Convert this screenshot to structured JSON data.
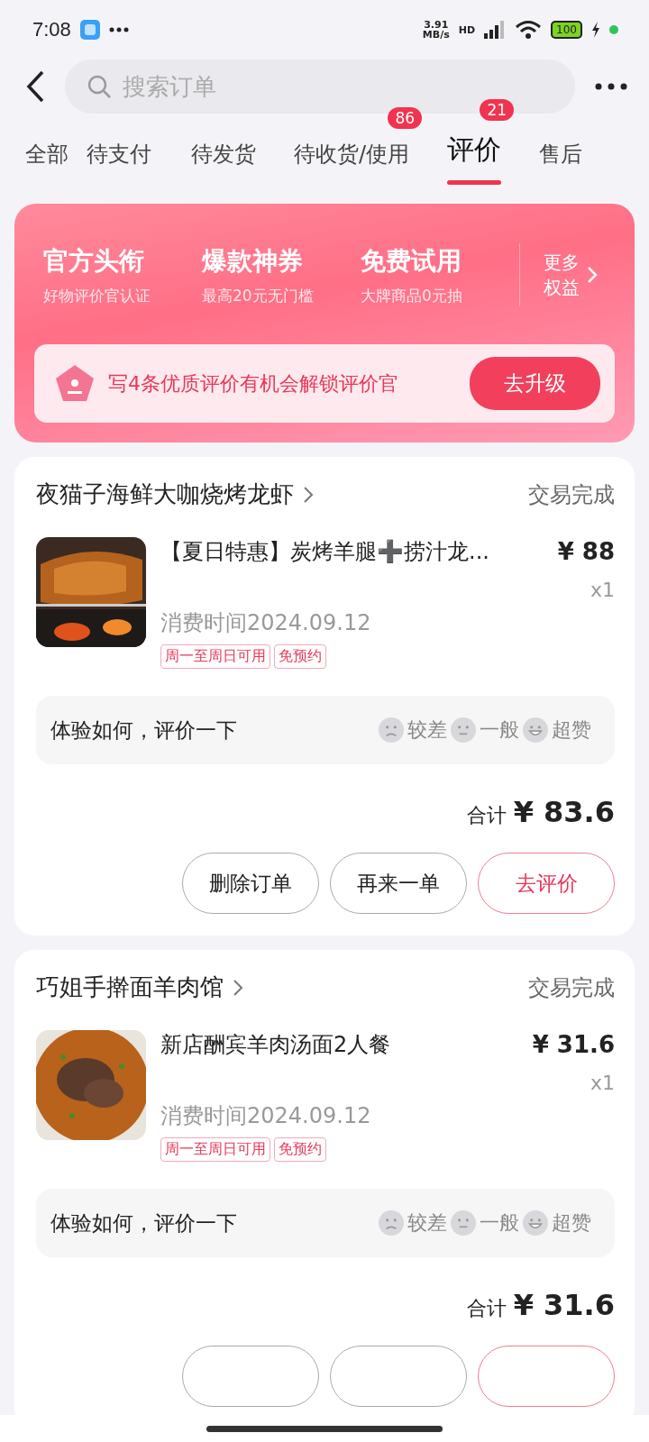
{
  "status_bar": {
    "time": "7:08",
    "speed": "3.91\nMB/s",
    "network": "HD",
    "battery": "100"
  },
  "search": {
    "placeholder": "搜索订单"
  },
  "tabs": [
    {
      "label": "全部",
      "selected": false
    },
    {
      "label": "待支付",
      "selected": false
    },
    {
      "label": "待发货",
      "selected": false
    },
    {
      "label": "待收货/使用",
      "selected": false,
      "badge": "86"
    },
    {
      "label": "评价",
      "selected": true,
      "badge": "21"
    },
    {
      "label": "售后",
      "selected": false
    }
  ],
  "banner": {
    "benefits": [
      {
        "title": "官方头衔",
        "subtitle": "好物评价官认证"
      },
      {
        "title": "爆款神券",
        "subtitle": "最高20元无门槛"
      },
      {
        "title": "免费试用",
        "subtitle": "大牌商品0元抽"
      }
    ],
    "more": [
      "更多",
      "权益"
    ],
    "promo": "写4条优质评价有机会解锁评价官",
    "upgrade_button": "去升级"
  },
  "orders": [
    {
      "shop": "夜猫子海鲜大咖烧烤龙虾",
      "status": "交易完成",
      "product": "【夏日特惠】炭烤羊腿➕捞汁龙...",
      "price": "¥ 88",
      "quantity": "x1",
      "time": "消费时间2024.09.12",
      "tags": [
        "周一至周日可用",
        "免预约"
      ],
      "prompt": "体验如何，评价一下",
      "ratings": [
        {
          "kind": "bad",
          "label": "较差"
        },
        {
          "kind": "ok",
          "label": "一般"
        },
        {
          "kind": "great",
          "label": "超赞"
        }
      ],
      "total_label": "合计",
      "total": "¥ 83.6",
      "buttons": [
        {
          "kind": "plain",
          "label": "删除订单"
        },
        {
          "kind": "plain",
          "label": "再来一单"
        },
        {
          "kind": "primary",
          "label": "去评价"
        }
      ]
    },
    {
      "shop": "巧姐手擀面羊肉馆",
      "status": "交易完成",
      "product": "新店酬宾羊肉汤面2人餐",
      "price": "¥ 31.6",
      "quantity": "x1",
      "time": "消费时间2024.09.12",
      "tags": [
        "周一至周日可用",
        "免预约"
      ],
      "prompt": "体验如何，评价一下",
      "ratings": [
        {
          "kind": "bad",
          "label": "较差"
        },
        {
          "kind": "ok",
          "label": "一般"
        },
        {
          "kind": "great",
          "label": "超赞"
        }
      ],
      "total_label": "合计",
      "total": "¥ 31.6",
      "buttons": [
        {
          "kind": "plain"
        },
        {
          "kind": "plain"
        },
        {
          "kind": "primary"
        }
      ]
    }
  ]
}
